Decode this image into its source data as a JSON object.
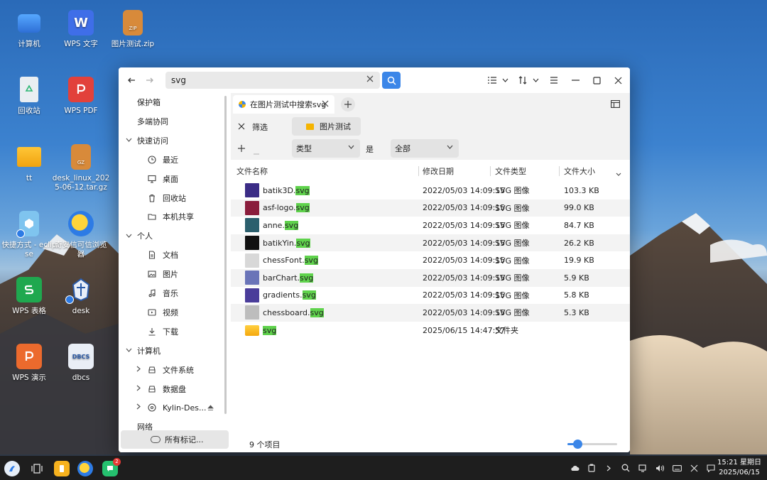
{
  "desktop": {
    "icons": [
      {
        "label": "计算机"
      },
      {
        "label": "WPS 文字"
      },
      {
        "label": "图片测试.zip"
      },
      {
        "label": "回收站"
      },
      {
        "label": "WPS PDF"
      },
      {
        "label": "tt"
      },
      {
        "label": "desk_linux_2025-06-12.tar.gz"
      },
      {
        "label": "快捷方式 - eclipse"
      },
      {
        "label": "奇安信可信浏览器"
      },
      {
        "label": "WPS 表格"
      },
      {
        "label": "desk"
      },
      {
        "label": "WPS 演示"
      },
      {
        "label": "dbcs"
      }
    ],
    "wps_w_glyph": "W",
    "zip_glyph": "ZIP",
    "gz_glyph": "GZ",
    "dbcs_glyph": "DBCS"
  },
  "toolbar": {
    "search_value": "svg"
  },
  "sidebar": {
    "items": [
      {
        "label": "保护箱",
        "level": 0
      },
      {
        "label": "多端协同",
        "level": 0
      },
      {
        "label": "快速访问",
        "level": 0,
        "expanded": true
      },
      {
        "label": "最近",
        "level": 1,
        "icon": "clock-icon"
      },
      {
        "label": "桌面",
        "level": 1,
        "icon": "desktop-icon"
      },
      {
        "label": "回收站",
        "level": 1,
        "icon": "trash-icon"
      },
      {
        "label": "本机共享",
        "level": 1,
        "icon": "folder-icon"
      },
      {
        "label": "个人",
        "level": 0,
        "expanded": true
      },
      {
        "label": "文档",
        "level": 1,
        "icon": "document-icon"
      },
      {
        "label": "图片",
        "level": 1,
        "icon": "picture-icon"
      },
      {
        "label": "音乐",
        "level": 1,
        "icon": "music-icon"
      },
      {
        "label": "视频",
        "level": 1,
        "icon": "video-icon"
      },
      {
        "label": "下载",
        "level": 1,
        "icon": "download-icon"
      },
      {
        "label": "计算机",
        "level": 0,
        "expanded": true
      },
      {
        "label": "文件系统",
        "level": 1,
        "icon": "drive-icon",
        "collapsed": true
      },
      {
        "label": "数据盘",
        "level": 1,
        "icon": "drive-icon",
        "collapsed": true
      },
      {
        "label": "Kylin-Des...",
        "level": 1,
        "icon": "disc-icon",
        "collapsed": true
      },
      {
        "label": "网络",
        "level": 0
      }
    ],
    "bottom_label": "所有标记..."
  },
  "tab": {
    "label": "在图片测试中搜索svg"
  },
  "filter": {
    "label": "筛选",
    "location": "图片测试"
  },
  "condition": {
    "field": "类型",
    "operator": "是",
    "value": "全部"
  },
  "table": {
    "headers": [
      "文件名称",
      "修改日期",
      "文件类型",
      "文件大小"
    ],
    "rows": [
      {
        "base": "batik3D.",
        "ext": "svg",
        "date": "2022/05/03 14:09:15",
        "type": "SVG 图像",
        "size": "103.3 KB",
        "thumb": "#3b2c86"
      },
      {
        "base": "asf-logo.",
        "ext": "svg",
        "date": "2022/05/03 14:09:15",
        "type": "SVG 图像",
        "size": "99.0 KB",
        "thumb": "#8a1d3c"
      },
      {
        "base": "anne.",
        "ext": "svg",
        "date": "2022/05/03 14:09:15",
        "type": "SVG 图像",
        "size": "84.7 KB",
        "thumb": "#2b5f6d"
      },
      {
        "base": "batikYin.",
        "ext": "svg",
        "date": "2022/05/03 14:09:15",
        "type": "SVG 图像",
        "size": "26.2 KB",
        "thumb": "#111111"
      },
      {
        "base": "chessFont.",
        "ext": "svg",
        "date": "2022/05/03 14:09:15",
        "type": "SVG 图像",
        "size": "19.9 KB",
        "thumb": "#d8d8d8"
      },
      {
        "base": "barChart.",
        "ext": "svg",
        "date": "2022/05/03 14:09:15",
        "type": "SVG 图像",
        "size": "5.9 KB",
        "thumb": "#6a74b8"
      },
      {
        "base": "gradients.",
        "ext": "svg",
        "date": "2022/05/03 14:09:15",
        "type": "SVG 图像",
        "size": "5.8 KB",
        "thumb": "#4a3d9a"
      },
      {
        "base": "chessboard.",
        "ext": "svg",
        "date": "2022/05/03 14:09:15",
        "type": "SVG 图像",
        "size": "5.3 KB",
        "thumb": "#bdbdbd"
      },
      {
        "base": "",
        "ext": "svg",
        "date": "2025/06/15 14:47:57",
        "type": "文件夹",
        "size": "",
        "thumb": "folder"
      }
    ]
  },
  "status": {
    "count": "9 个项目",
    "zoom_fraction": 0.2
  },
  "taskbar": {
    "badge": "2",
    "time": "15:21 星期日",
    "date": "2025/06/15"
  },
  "colors": {
    "accent": "#3b86e8",
    "highlight": "#5fd24c"
  }
}
